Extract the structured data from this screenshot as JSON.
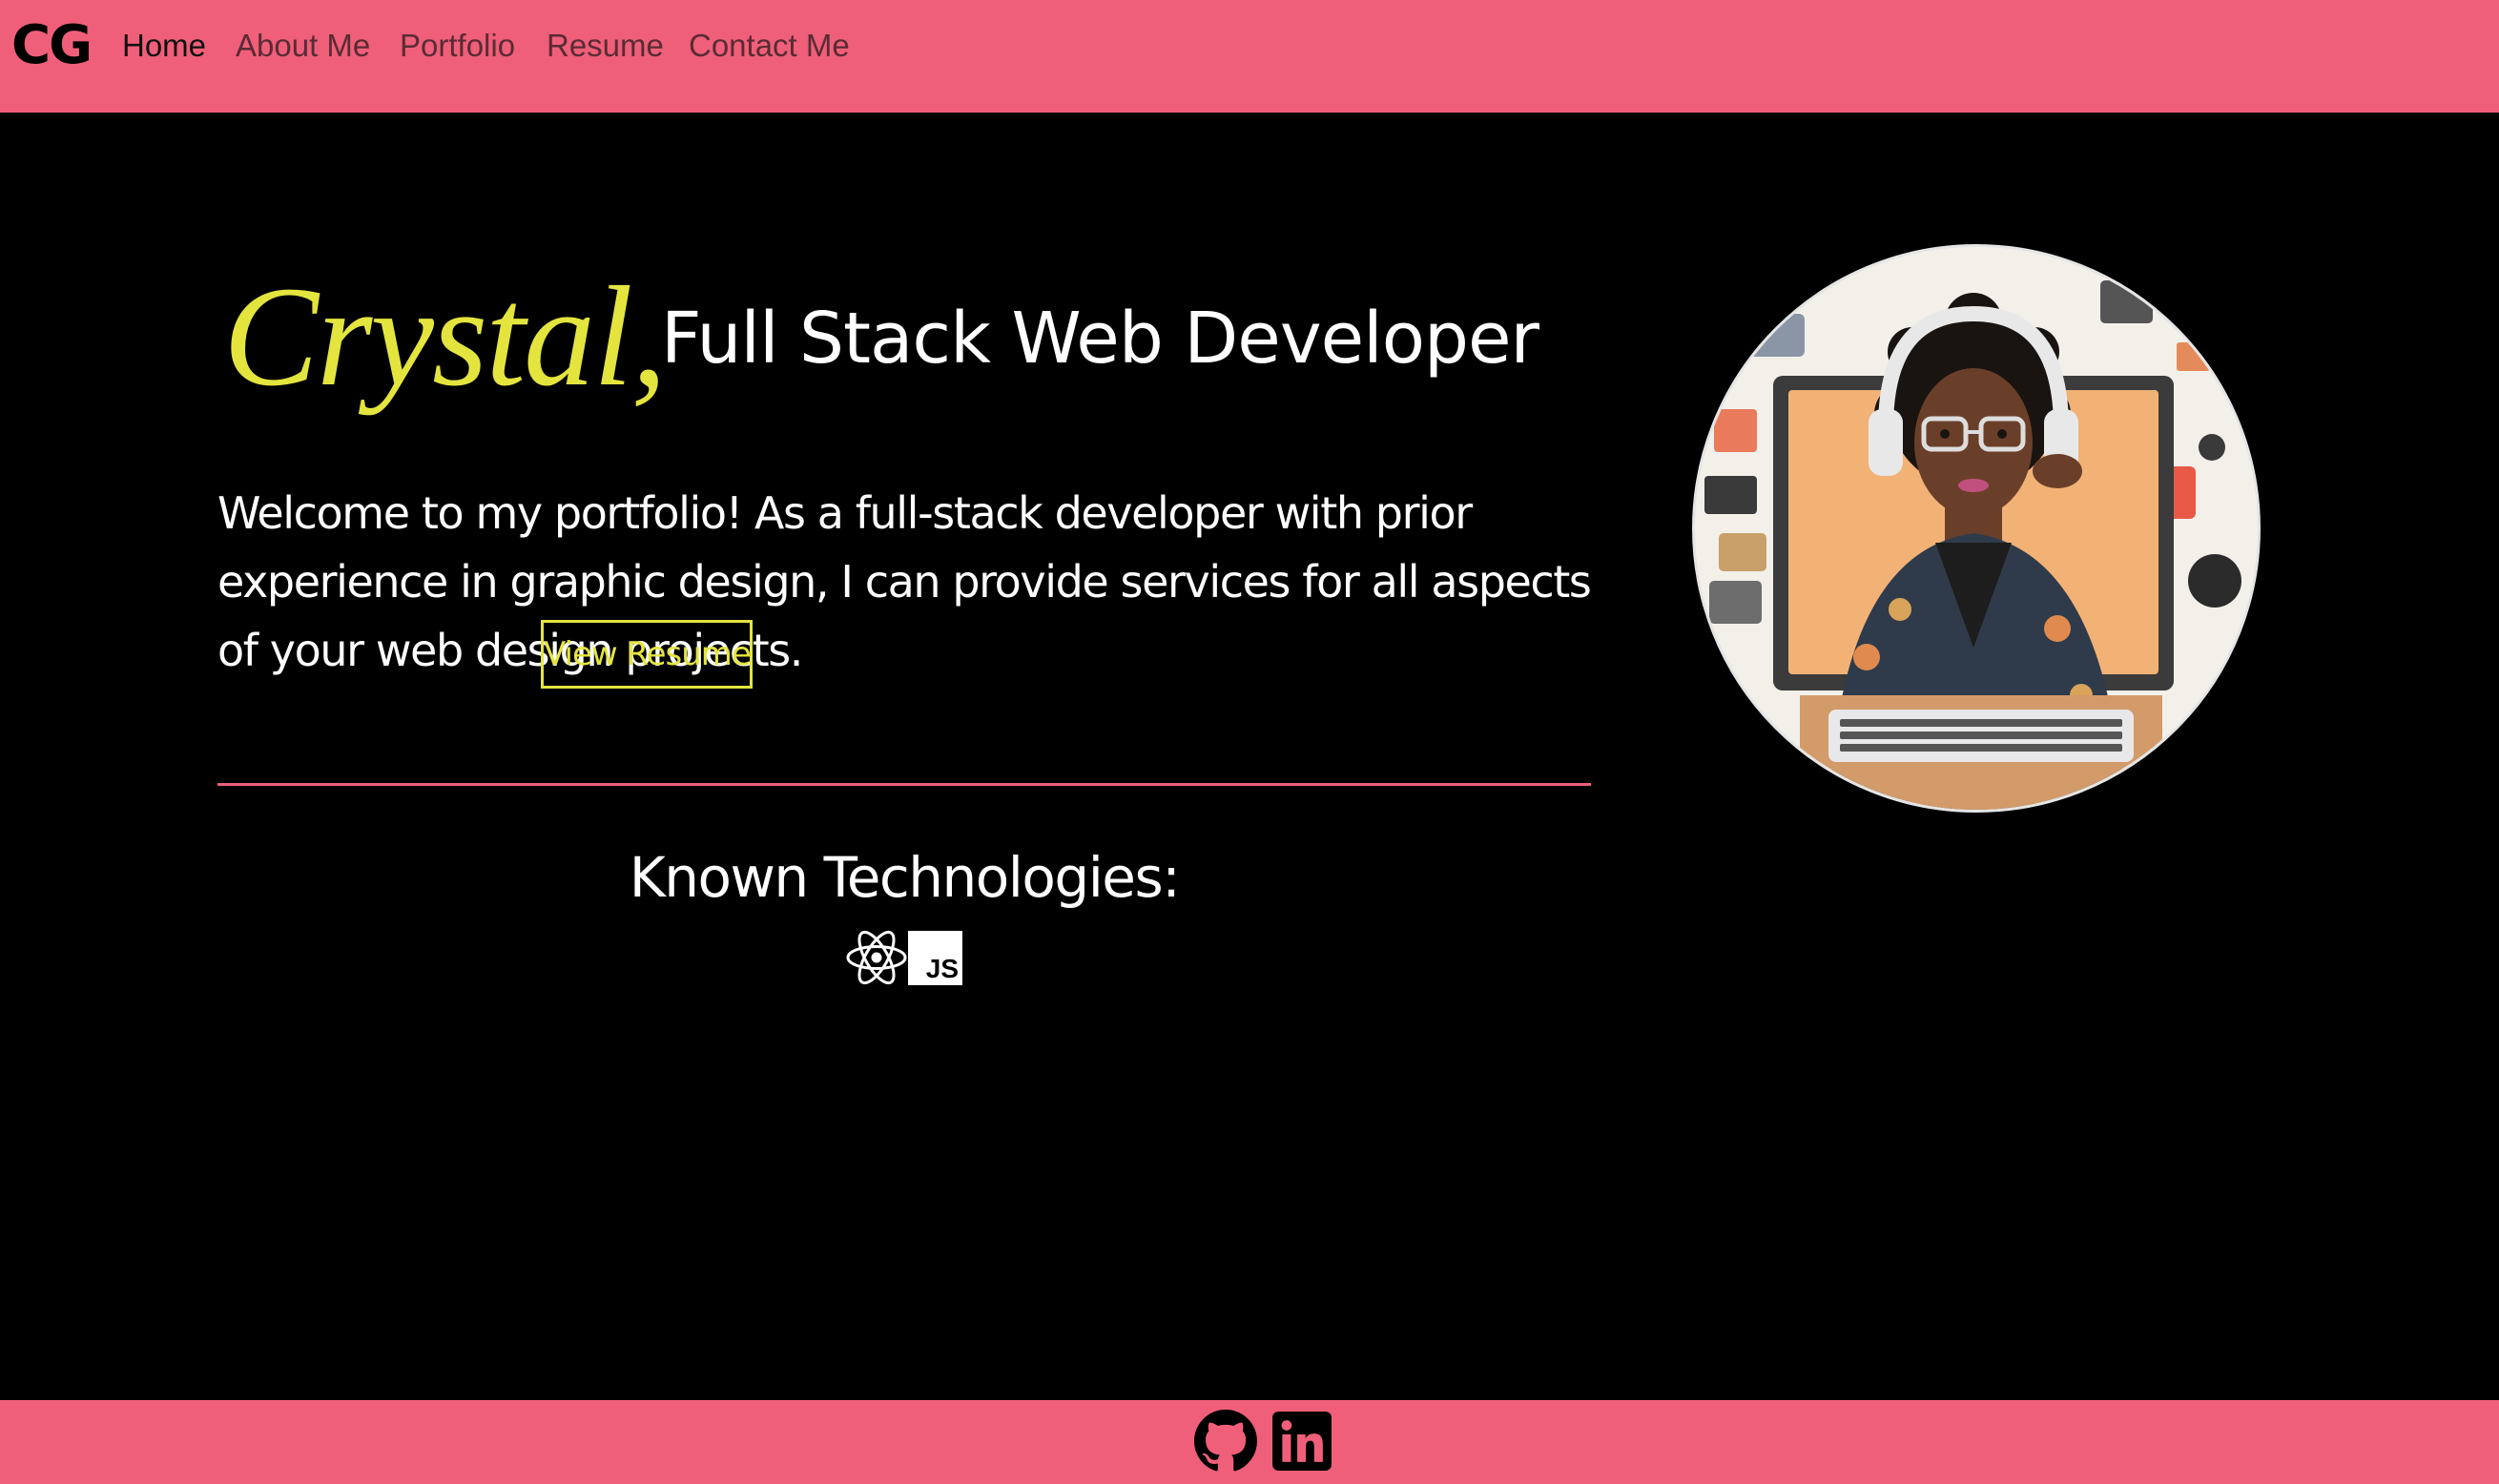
{
  "nav": {
    "brand": "CG",
    "links": [
      {
        "label": "Home",
        "active": true
      },
      {
        "label": "About Me",
        "active": false
      },
      {
        "label": "Portfolio",
        "active": false
      },
      {
        "label": "Resume",
        "active": false
      },
      {
        "label": "Contact Me",
        "active": false
      }
    ]
  },
  "hero": {
    "name": "Crystal,",
    "role": "Full Stack Web Developer",
    "intro": "Welcome to my portfolio! As a full-stack developer with prior experience in graphic design, I can provide services for all aspects of your web design projects.",
    "resume_button": "View Resume"
  },
  "technologies": {
    "title": "Known Technologies:",
    "items": [
      {
        "name": "React",
        "icon": "react-icon"
      },
      {
        "name": "JavaScript",
        "icon": "javascript-icon",
        "badge": "JS"
      }
    ]
  },
  "footer": {
    "links": [
      {
        "name": "GitHub",
        "icon": "github-icon"
      },
      {
        "name": "LinkedIn",
        "icon": "linkedin-icon"
      }
    ]
  },
  "colors": {
    "accent_pink": "#ef5f79",
    "accent_yellow": "#e4e43f",
    "background": "#000000",
    "text": "#ffffff"
  }
}
